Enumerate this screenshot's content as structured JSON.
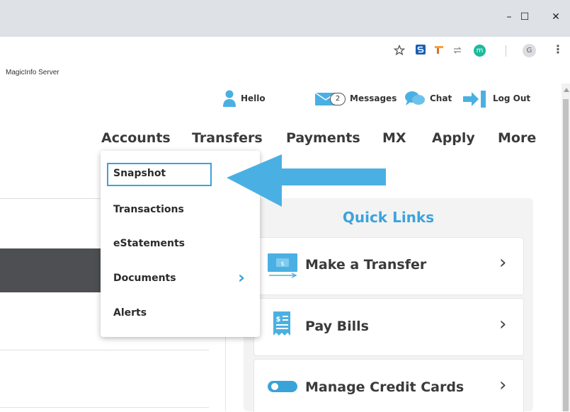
{
  "browser": {
    "window_controls": {
      "minimize": "–",
      "maximize": "☐",
      "close": "✕"
    },
    "bookmark_label": "MagicInfo Server",
    "toolbar_icons": [
      "star-icon",
      "s-extension-icon",
      "pin-extension-icon",
      "sync-icon",
      "m-avatar-icon",
      "g-profile-icon",
      "kebab-menu-icon"
    ],
    "m_avatar_letter": "m",
    "g_profile_letter": "G",
    "kebab": "⋮"
  },
  "utility_bar": {
    "hello": "Hello",
    "messages_count": "2",
    "messages": "Messages",
    "chat": "Chat",
    "logout": "Log Out"
  },
  "nav": {
    "items": [
      "Accounts",
      "Transfers",
      "Payments",
      "MX",
      "Apply",
      "More"
    ]
  },
  "accounts_menu": {
    "items": [
      "Snapshot",
      "Transactions",
      "eStatements",
      "Documents",
      "Alerts"
    ],
    "submenu_indicator": "›"
  },
  "quick_links": {
    "title": "Quick Links",
    "items": [
      "Make a Transfer",
      "Pay Bills",
      "Manage Credit Cards"
    ],
    "chevron": "›"
  },
  "colors": {
    "accent_blue": "#3aa3d8",
    "link_blue": "#3ca3dd",
    "arrow_blue": "#4ab0e3",
    "dark_bar": "#4d4f53"
  }
}
